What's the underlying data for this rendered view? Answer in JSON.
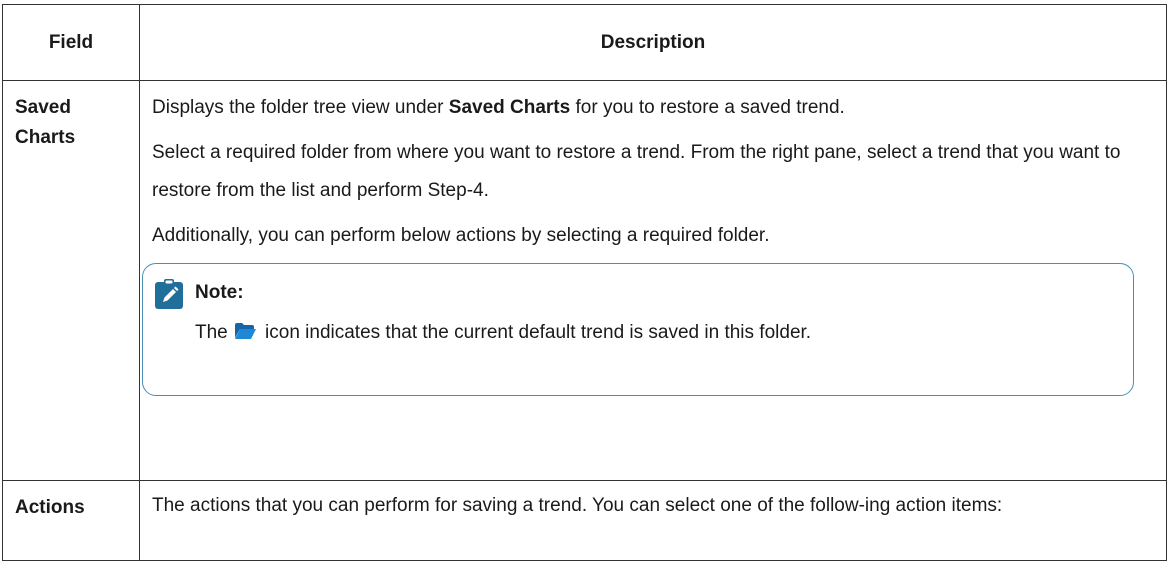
{
  "table": {
    "headers": {
      "field": "Field",
      "description": "Description"
    },
    "rows": [
      {
        "field_line1": "Saved",
        "field_line2": "Charts",
        "p1_before": "Displays the folder tree view under ",
        "p1_bold": "Saved Charts",
        "p1_after": " for you to restore a saved trend.",
        "p2": "Select a required folder from where you want to restore a trend. From the right pane, select a trend that you want to restore from the list and perform Step-4.",
        "p3": "Additionally, you can perform below actions by selecting a required folder.",
        "note": {
          "title": "Note:",
          "text_before": "The",
          "icon": "open-folder-icon",
          "text_after": "icon indicates that the current default trend is saved in this folder."
        }
      },
      {
        "field": "Actions",
        "text": "The actions that you can perform for saving a trend. You can select one of the follow-ing action items:"
      }
    ]
  },
  "colors": {
    "border": "#333333",
    "note_border": "#4a8fb3",
    "note_icon": "#1f6f9a",
    "folder_icon": "#1e88d6"
  }
}
